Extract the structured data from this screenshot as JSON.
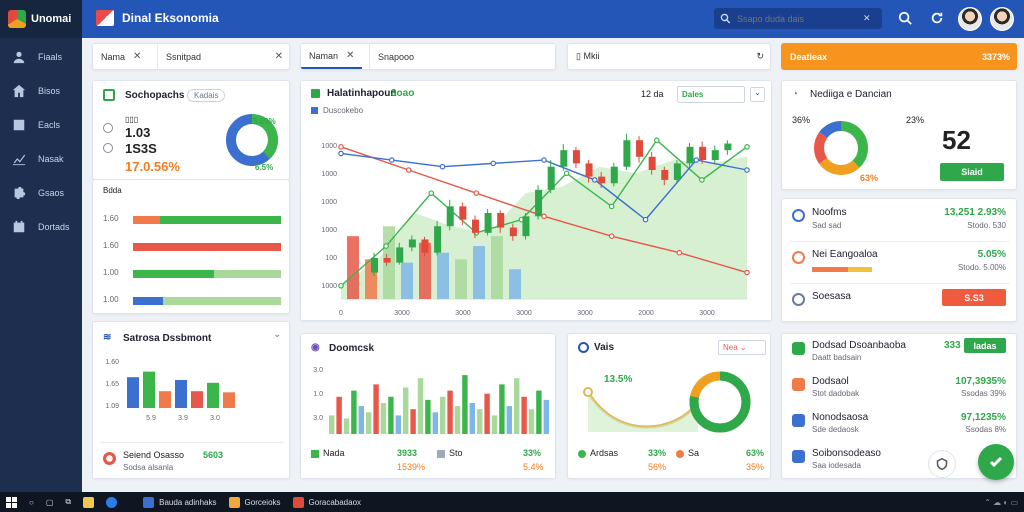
{
  "app": {
    "brand": "Unomai",
    "title": "Dinal Eksonomia"
  },
  "search": {
    "placeholder": "Ssapo duda dais"
  },
  "sidebar": {
    "items": [
      {
        "label": "Fiaals",
        "icon": "users-icon"
      },
      {
        "label": "Bisos",
        "icon": "home-icon"
      },
      {
        "label": "Eacls",
        "icon": "document-icon"
      },
      {
        "label": "Nasak",
        "icon": "chart-icon"
      },
      {
        "label": "Gsaos",
        "icon": "puzzle-icon"
      },
      {
        "label": "Dortads",
        "icon": "calendar-icon"
      }
    ]
  },
  "tabs": {
    "group1": [
      "Nama",
      "Ssnitpad"
    ],
    "group2": [
      "Naman",
      "Snapooo"
    ],
    "group3": [
      "Mkii"
    ],
    "orange": {
      "label": "Deatieax",
      "value": "3373%"
    }
  },
  "summary": {
    "title": "Sochopachs",
    "chip": "Kadais",
    "line1": "1.03",
    "line2": "1S3S",
    "line3": "17.0.56%",
    "donut_pct1": "5.09%",
    "donut_pct2": "6.5%"
  },
  "hbars": {
    "header": "Bdda",
    "rows": [
      {
        "label": "1.60",
        "segments": [
          {
            "frac": 0.18,
            "color": "#f07a4a"
          },
          {
            "frac": 0.82,
            "color": "#3cb54a"
          }
        ]
      },
      {
        "label": "1.60",
        "segments": [
          {
            "frac": 1.0,
            "color": "#e8584a"
          }
        ]
      },
      {
        "label": "1.00",
        "segments": [
          {
            "frac": 0.55,
            "color": "#3cb54a"
          },
          {
            "frac": 0.45,
            "color": "#a8d89a"
          }
        ]
      },
      {
        "label": "1.00",
        "segments": [
          {
            "frac": 0.2,
            "color": "#3b6fd0"
          },
          {
            "frac": 0.8,
            "color": "#a8d89a"
          }
        ]
      }
    ]
  },
  "main_chart": {
    "title": "Halatinhapoun",
    "title_badge": "3oao",
    "legend": "Duscokebo",
    "controls": {
      "period": "12 da",
      "mode": "Dales"
    },
    "yticks": [
      "1000",
      "1000",
      "1000",
      "1000",
      "100",
      "1000"
    ],
    "xticks": [
      "0",
      "3000",
      "3000",
      "3000",
      "3000",
      "2000",
      "3000"
    ]
  },
  "chart_data": {
    "type": "line",
    "title": "Halatinhapoun",
    "candles": [
      {
        "o": 40,
        "c": 62,
        "h": 70,
        "l": 35
      },
      {
        "o": 62,
        "c": 55,
        "h": 68,
        "l": 50
      },
      {
        "o": 55,
        "c": 78,
        "h": 85,
        "l": 52
      },
      {
        "o": 78,
        "c": 90,
        "h": 96,
        "l": 72
      },
      {
        "o": 90,
        "c": 70,
        "h": 94,
        "l": 65
      },
      {
        "o": 70,
        "c": 110,
        "h": 118,
        "l": 66
      },
      {
        "o": 110,
        "c": 140,
        "h": 150,
        "l": 104
      },
      {
        "o": 140,
        "c": 120,
        "h": 146,
        "l": 112
      },
      {
        "o": 120,
        "c": 100,
        "h": 126,
        "l": 92
      },
      {
        "o": 100,
        "c": 130,
        "h": 136,
        "l": 96
      },
      {
        "o": 130,
        "c": 108,
        "h": 134,
        "l": 100
      },
      {
        "o": 108,
        "c": 95,
        "h": 114,
        "l": 88
      },
      {
        "o": 95,
        "c": 125,
        "h": 130,
        "l": 90
      },
      {
        "o": 125,
        "c": 165,
        "h": 172,
        "l": 120
      },
      {
        "o": 165,
        "c": 200,
        "h": 210,
        "l": 160
      },
      {
        "o": 200,
        "c": 225,
        "h": 234,
        "l": 194
      },
      {
        "o": 225,
        "c": 205,
        "h": 230,
        "l": 198
      },
      {
        "o": 205,
        "c": 185,
        "h": 210,
        "l": 176
      },
      {
        "o": 185,
        "c": 175,
        "h": 192,
        "l": 168
      },
      {
        "o": 175,
        "c": 200,
        "h": 206,
        "l": 170
      },
      {
        "o": 200,
        "c": 240,
        "h": 250,
        "l": 195
      },
      {
        "o": 240,
        "c": 215,
        "h": 246,
        "l": 206
      },
      {
        "o": 215,
        "c": 195,
        "h": 222,
        "l": 188
      },
      {
        "o": 195,
        "c": 180,
        "h": 200,
        "l": 172
      },
      {
        "o": 180,
        "c": 205,
        "h": 210,
        "l": 176
      },
      {
        "o": 205,
        "c": 230,
        "h": 236,
        "l": 200
      },
      {
        "o": 230,
        "c": 210,
        "h": 238,
        "l": 204
      },
      {
        "o": 210,
        "c": 225,
        "h": 232,
        "l": 205
      },
      {
        "o": 225,
        "c": 235,
        "h": 240,
        "l": 218
      }
    ],
    "lines": [
      {
        "color": "#e8584a",
        "y": [
          230,
          195,
          160,
          125,
          95,
          70,
          40
        ]
      },
      {
        "color": "#3cb54a",
        "y": [
          20,
          80,
          160,
          100,
          120,
          190,
          140,
          240,
          180,
          230
        ]
      },
      {
        "color": "#3b6fd0",
        "y": [
          220,
          210,
          200,
          205,
          210,
          180,
          120,
          210,
          195
        ]
      }
    ],
    "bars": [
      95,
      60,
      110,
      55,
      85,
      70,
      60,
      80,
      95,
      45
    ],
    "area": [
      20,
      60,
      130,
      110,
      100,
      160,
      170,
      200,
      190,
      210,
      205,
      215
    ]
  },
  "funnel_card": {
    "title": "Satrosa Dssbmont",
    "yticks": [
      "1.60",
      "1.65",
      "1.09"
    ],
    "xticks": [
      "5.9",
      "3.9",
      "3.0"
    ],
    "bars": [
      {
        "v": 0.55,
        "color": "#3b6fd0"
      },
      {
        "v": 0.65,
        "color": "#3cb54a"
      },
      {
        "v": 0.3,
        "color": "#f07a4a"
      },
      {
        "v": 0.5,
        "color": "#3b6fd0"
      },
      {
        "v": 0.3,
        "color": "#e8584a"
      },
      {
        "v": 0.45,
        "color": "#3cb54a"
      },
      {
        "v": 0.28,
        "color": "#f07a4a"
      }
    ],
    "foot_label": "Seiend Osasso",
    "foot_value": "5603",
    "foot_sub": "Sodsa alsanla"
  },
  "small_bars": {
    "title": "Doomcsk",
    "yticks": [
      "3.0",
      "1.0",
      "3.0"
    ],
    "values": [
      0.3,
      0.6,
      0.25,
      0.7,
      0.45,
      0.35,
      0.8,
      0.5,
      0.6,
      0.3,
      0.75,
      0.4,
      0.9,
      0.55,
      0.35,
      0.6,
      0.7,
      0.45,
      0.95,
      0.5,
      0.4,
      0.65,
      0.3,
      0.8,
      0.45,
      0.9,
      0.6,
      0.4,
      0.7,
      0.55
    ],
    "legend": [
      {
        "label": "Nada",
        "value": "3933",
        "sub": "1539%"
      },
      {
        "label": "Sto",
        "value": "33%",
        "sub": "5.4%"
      }
    ]
  },
  "gauge": {
    "title": "Vais",
    "dropdown": "Nea",
    "pct": "13.5%",
    "ring_value": 0.78,
    "legend": [
      {
        "label": "Ardsas",
        "value": "33%",
        "sub": "56%"
      },
      {
        "label": "Sa",
        "value": "63%",
        "sub": "35%"
      }
    ]
  },
  "donut_card": {
    "title": "Nediiga e Dancian",
    "pct_left": "36%",
    "pct_mid": "23%",
    "bottom_pct": "63%",
    "big_number": "52",
    "button": "Siaid",
    "slices": [
      0.38,
      0.27,
      0.2,
      0.15
    ]
  },
  "kpi_list": [
    {
      "title": "Noofms",
      "sub": "Sad sad",
      "value": "13,251 2.93%",
      "sub_value": "Stodo. 530"
    },
    {
      "title": "Nei Eangoaloa",
      "sub": "",
      "value": "5.05%",
      "sub_value": "Stodo. 5.00%"
    },
    {
      "title": "Soesasa",
      "sub": "",
      "value": "",
      "sub_value": "",
      "button": "S.S3"
    }
  ],
  "activity": [
    {
      "title": "Dodsad Dsoanbaoba",
      "sub": "Daatt badsain",
      "value": "333",
      "button": "Iadas"
    },
    {
      "title": "Dodsaol",
      "sub": "Stot dadobak",
      "value": "107,3935%",
      "sub_value": "Ssodas 39%"
    },
    {
      "title": "Nonodsaosa",
      "sub": "Sde dedaosk",
      "value": "97,1235%",
      "sub_value": "Ssodas 8%"
    },
    {
      "title": "Soibonsodeaso",
      "sub": "Saa iodesada",
      "value": "",
      "sub_value": ""
    }
  ],
  "taskbar": {
    "items": [
      "Bauda adinhaks",
      "Gorceioks",
      "Goracabadaox"
    ]
  }
}
